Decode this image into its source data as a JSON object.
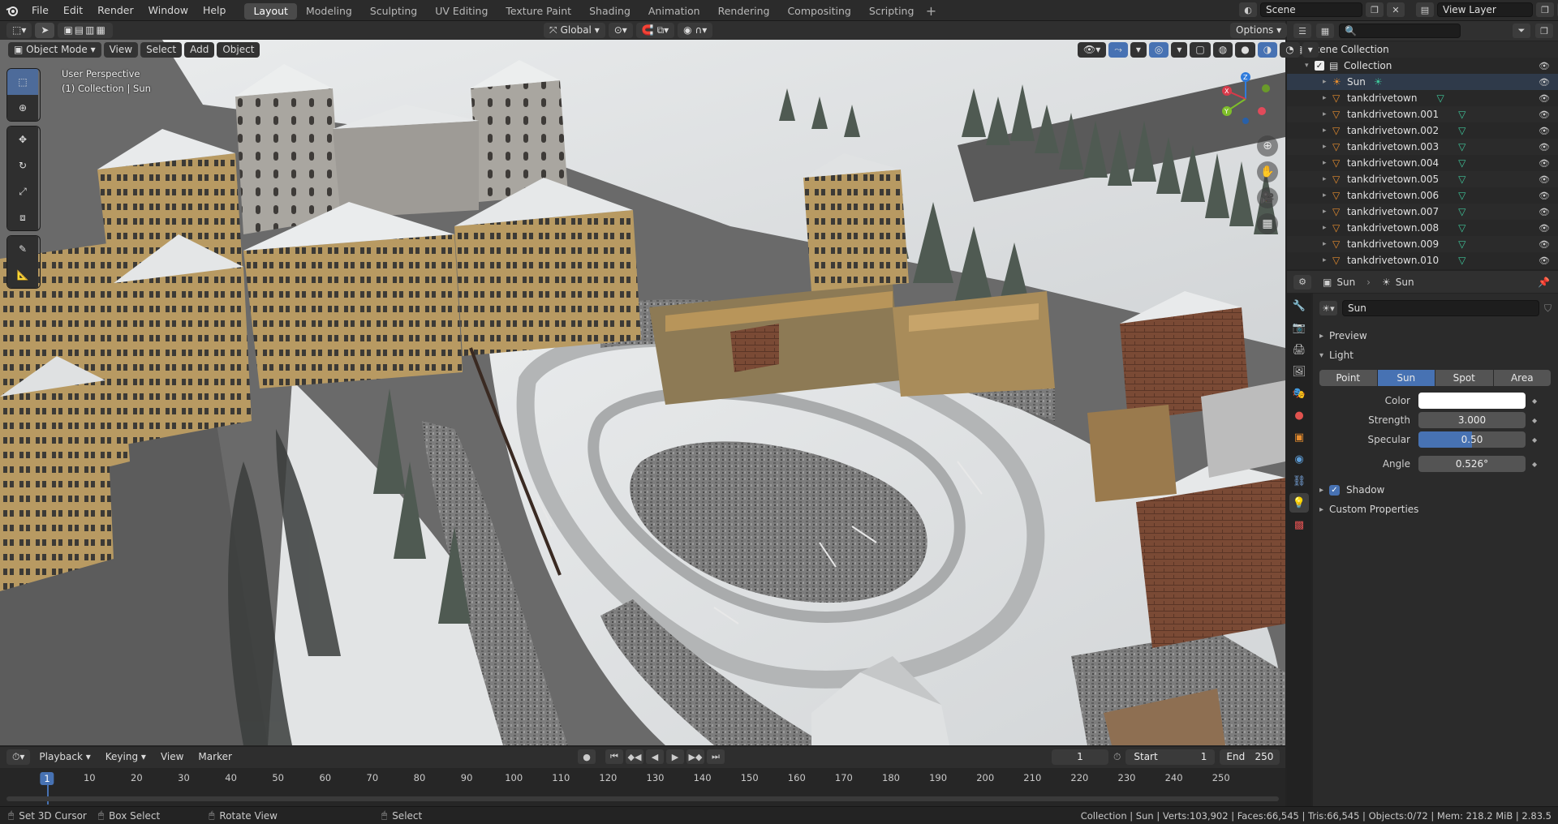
{
  "menus": [
    "File",
    "Edit",
    "Render",
    "Window",
    "Help"
  ],
  "workspaces": [
    {
      "label": "Layout",
      "active": true
    },
    {
      "label": "Modeling"
    },
    {
      "label": "Sculpting"
    },
    {
      "label": "UV Editing"
    },
    {
      "label": "Texture Paint"
    },
    {
      "label": "Shading"
    },
    {
      "label": "Animation"
    },
    {
      "label": "Rendering"
    },
    {
      "label": "Compositing"
    },
    {
      "label": "Scripting"
    }
  ],
  "scene": {
    "name": "Scene",
    "view_layer": "View Layer"
  },
  "viewport_header": {
    "mode": "Object Mode",
    "view": "View",
    "select": "Select",
    "add": "Add",
    "object": "Object",
    "orientation": "Global",
    "options": "Options"
  },
  "viewport_overlay": {
    "perspective": "User Perspective",
    "collection_info": "(1) Collection | Sun"
  },
  "gizmo_axes": [
    "X",
    "Y",
    "Z"
  ],
  "outliner": {
    "root": "Scene Collection",
    "collection": "Collection",
    "items": [
      "Sun",
      "tankdrivetown",
      "tankdrivetown.001",
      "tankdrivetown.002",
      "tankdrivetown.003",
      "tankdrivetown.004",
      "tankdrivetown.005",
      "tankdrivetown.006",
      "tankdrivetown.007",
      "tankdrivetown.008",
      "tankdrivetown.009",
      "tankdrivetown.010"
    ]
  },
  "properties": {
    "breadcrumb_object": "Sun",
    "breadcrumb_data": "Sun",
    "data_name": "Sun",
    "panels": {
      "preview": "Preview",
      "light": "Light",
      "shadow": "Shadow",
      "custom": "Custom Properties"
    },
    "light_types": [
      "Point",
      "Sun",
      "Spot",
      "Area"
    ],
    "active_light_type": "Sun",
    "color_label": "Color",
    "color_value": "#ffffff",
    "strength_label": "Strength",
    "strength": "3.000",
    "specular_label": "Specular",
    "specular": "0.50",
    "specular_fraction": 0.5,
    "angle_label": "Angle",
    "angle": "0.526°"
  },
  "timeline": {
    "playback": "Playback",
    "keying": "Keying",
    "view": "View",
    "marker": "Marker",
    "current_frame": "1",
    "start_label": "Start",
    "start": "1",
    "end_label": "End",
    "end": "250",
    "ruler": [
      "1",
      "10",
      "20",
      "30",
      "40",
      "50",
      "60",
      "70",
      "80",
      "90",
      "100",
      "110",
      "120",
      "130",
      "140",
      "150",
      "160",
      "170",
      "180",
      "190",
      "200",
      "210",
      "220",
      "230",
      "240",
      "250"
    ]
  },
  "statusbar": {
    "set_cursor": "Set 3D Cursor",
    "box_select": "Box Select",
    "rotate_view": "Rotate View",
    "select": "Select",
    "stats": "Collection | Sun | Verts:103,902 | Faces:66,545 | Tris:66,545 | Objects:0/72 | Mem: 218.2 MiB | 2.83.5"
  },
  "colors": {
    "accent": "#4772b3",
    "snow": "#e3e5e6",
    "object_orange": "#e58c2e",
    "mesh_green": "#3fc69a"
  }
}
